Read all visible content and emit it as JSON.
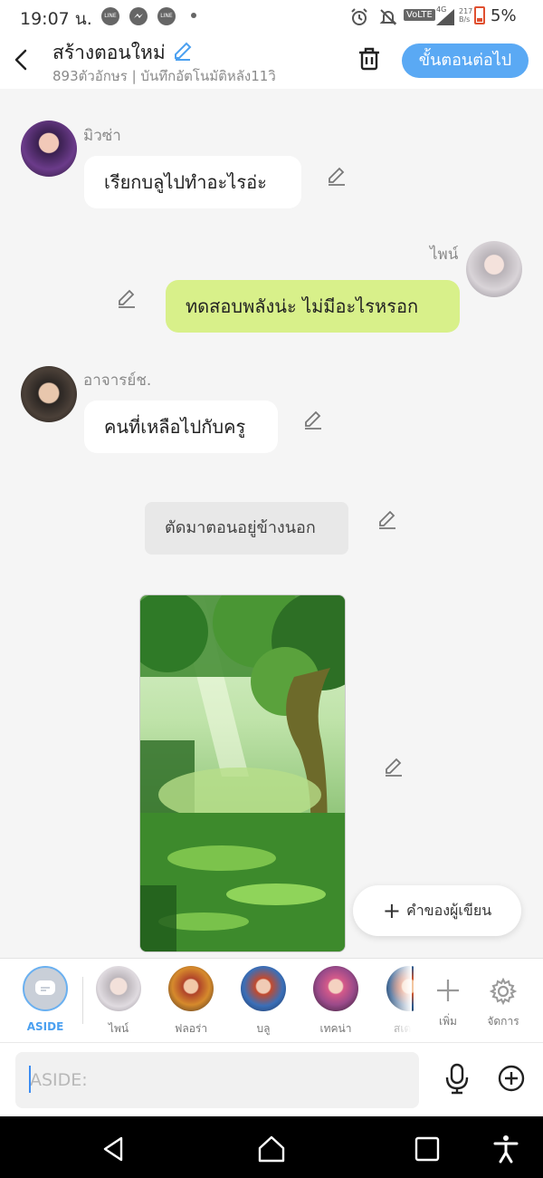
{
  "status_bar": {
    "time": "19:07 น.",
    "app_icons": [
      "LINE",
      "messenger-icon",
      "LINE"
    ],
    "volte": "VoLTE",
    "network": "4G",
    "speed": "217 B/s",
    "battery": "5%"
  },
  "header": {
    "title": "สร้างตอนใหม่",
    "subtitle": "893ตัวอักษร | บันทึกอัตโนมัติหลัง11วิ",
    "next_label": "ขั้นตอนต่อไป"
  },
  "messages": [
    {
      "speaker": "มิวซ่า",
      "text": "เรียกบลูไปทำอะไรอ่ะ",
      "side": "left"
    },
    {
      "speaker": "ไพน์",
      "text": "ทดสอบพลังน่ะ ไม่มีอะไรหรอก",
      "side": "right"
    },
    {
      "speaker": "อาจารย์ช.",
      "text": "คนที่เหลือไปกับครู",
      "side": "left"
    },
    {
      "speaker": "",
      "text": "ตัดมาตอนอยู่ข้างนอก",
      "side": "narration"
    }
  ],
  "author_button": {
    "label": "คำของผู้เขียน"
  },
  "characters": [
    {
      "name": "ASIDE"
    },
    {
      "name": "ไพน์"
    },
    {
      "name": "ฟลอร่า"
    },
    {
      "name": "บลู"
    },
    {
      "name": "เทคน่า"
    },
    {
      "name": "สเต"
    }
  ],
  "actions": {
    "add_label": "เพิ่ม",
    "manage_label": "จัดการ"
  },
  "input": {
    "placeholder": "ASIDE:"
  },
  "colors": {
    "accent": "#5aa9f4",
    "my_bubble": "#d8f08a",
    "background": "#f5f5f5"
  }
}
